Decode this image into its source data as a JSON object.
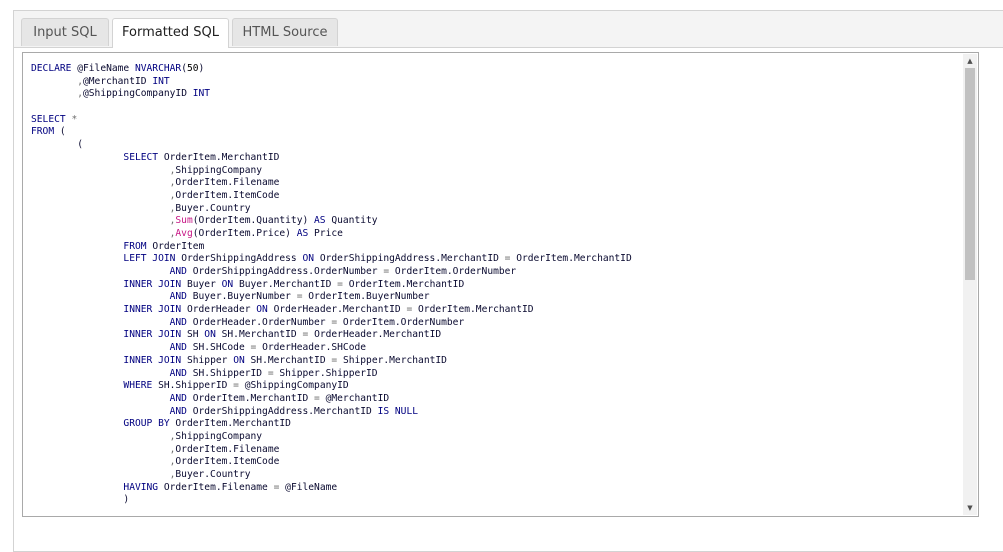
{
  "tabs": [
    {
      "label": "Input SQL"
    },
    {
      "label": "Formatted SQL"
    },
    {
      "label": "HTML Source"
    }
  ],
  "active_tab": "Formatted SQL",
  "scrollbar": {
    "up_icon": "▲",
    "down_icon": "▼"
  },
  "code_lines": [
    [
      [
        "kw",
        "DECLARE "
      ],
      [
        "id",
        "@FileName "
      ],
      [
        "kw",
        "NVARCHAR"
      ],
      [
        "id",
        "("
      ],
      [
        "num",
        "50"
      ],
      [
        "id",
        ")"
      ]
    ],
    [
      [
        "id",
        "        "
      ],
      [
        "op",
        ","
      ],
      [
        "id",
        "@MerchantID "
      ],
      [
        "kw",
        "INT"
      ]
    ],
    [
      [
        "id",
        "        "
      ],
      [
        "op",
        ","
      ],
      [
        "id",
        "@ShippingCompanyID "
      ],
      [
        "kw",
        "INT"
      ]
    ],
    [],
    [
      [
        "kw",
        "SELECT "
      ],
      [
        "op",
        "*"
      ]
    ],
    [
      [
        "kw",
        "FROM "
      ],
      [
        "id",
        "("
      ]
    ],
    [
      [
        "id",
        "        ("
      ]
    ],
    [
      [
        "id",
        "                "
      ],
      [
        "kw",
        "SELECT "
      ],
      [
        "id",
        "OrderItem.MerchantID"
      ]
    ],
    [
      [
        "id",
        "                        "
      ],
      [
        "op",
        ","
      ],
      [
        "id",
        "ShippingCompany"
      ]
    ],
    [
      [
        "id",
        "                        "
      ],
      [
        "op",
        ","
      ],
      [
        "id",
        "OrderItem.Filename"
      ]
    ],
    [
      [
        "id",
        "                        "
      ],
      [
        "op",
        ","
      ],
      [
        "id",
        "OrderItem.ItemCode"
      ]
    ],
    [
      [
        "id",
        "                        "
      ],
      [
        "op",
        ","
      ],
      [
        "id",
        "Buyer.Country"
      ]
    ],
    [
      [
        "id",
        "                        "
      ],
      [
        "op",
        ","
      ],
      [
        "fn",
        "Sum"
      ],
      [
        "id",
        "(OrderItem.Quantity) "
      ],
      [
        "kw",
        "AS "
      ],
      [
        "id",
        "Quantity"
      ]
    ],
    [
      [
        "id",
        "                        "
      ],
      [
        "op",
        ","
      ],
      [
        "fn",
        "Avg"
      ],
      [
        "id",
        "(OrderItem.Price) "
      ],
      [
        "kw",
        "AS "
      ],
      [
        "id",
        "Price"
      ]
    ],
    [
      [
        "id",
        "                "
      ],
      [
        "kw",
        "FROM "
      ],
      [
        "id",
        "OrderItem"
      ]
    ],
    [
      [
        "id",
        "                "
      ],
      [
        "kw",
        "LEFT JOIN "
      ],
      [
        "id",
        "OrderShippingAddress "
      ],
      [
        "kw",
        "ON "
      ],
      [
        "id",
        "OrderShippingAddress.MerchantID "
      ],
      [
        "op",
        "= "
      ],
      [
        "id",
        "OrderItem.MerchantID"
      ]
    ],
    [
      [
        "id",
        "                        "
      ],
      [
        "kw",
        "AND "
      ],
      [
        "id",
        "OrderShippingAddress.OrderNumber "
      ],
      [
        "op",
        "= "
      ],
      [
        "id",
        "OrderItem.OrderNumber"
      ]
    ],
    [
      [
        "id",
        "                "
      ],
      [
        "kw",
        "INNER JOIN "
      ],
      [
        "id",
        "Buyer "
      ],
      [
        "kw",
        "ON "
      ],
      [
        "id",
        "Buyer.MerchantID "
      ],
      [
        "op",
        "= "
      ],
      [
        "id",
        "OrderItem.MerchantID"
      ]
    ],
    [
      [
        "id",
        "                        "
      ],
      [
        "kw",
        "AND "
      ],
      [
        "id",
        "Buyer.BuyerNumber "
      ],
      [
        "op",
        "= "
      ],
      [
        "id",
        "OrderItem.BuyerNumber"
      ]
    ],
    [
      [
        "id",
        "                "
      ],
      [
        "kw",
        "INNER JOIN "
      ],
      [
        "id",
        "OrderHeader "
      ],
      [
        "kw",
        "ON "
      ],
      [
        "id",
        "OrderHeader.MerchantID "
      ],
      [
        "op",
        "= "
      ],
      [
        "id",
        "OrderItem.MerchantID"
      ]
    ],
    [
      [
        "id",
        "                        "
      ],
      [
        "kw",
        "AND "
      ],
      [
        "id",
        "OrderHeader.OrderNumber "
      ],
      [
        "op",
        "= "
      ],
      [
        "id",
        "OrderItem.OrderNumber"
      ]
    ],
    [
      [
        "id",
        "                "
      ],
      [
        "kw",
        "INNER JOIN "
      ],
      [
        "id",
        "SH "
      ],
      [
        "kw",
        "ON "
      ],
      [
        "id",
        "SH.MerchantID "
      ],
      [
        "op",
        "= "
      ],
      [
        "id",
        "OrderHeader.MerchantID"
      ]
    ],
    [
      [
        "id",
        "                        "
      ],
      [
        "kw",
        "AND "
      ],
      [
        "id",
        "SH.SHCode "
      ],
      [
        "op",
        "= "
      ],
      [
        "id",
        "OrderHeader.SHCode"
      ]
    ],
    [
      [
        "id",
        "                "
      ],
      [
        "kw",
        "INNER JOIN "
      ],
      [
        "id",
        "Shipper "
      ],
      [
        "kw",
        "ON "
      ],
      [
        "id",
        "SH.MerchantID "
      ],
      [
        "op",
        "= "
      ],
      [
        "id",
        "Shipper.MerchantID"
      ]
    ],
    [
      [
        "id",
        "                        "
      ],
      [
        "kw",
        "AND "
      ],
      [
        "id",
        "SH.ShipperID "
      ],
      [
        "op",
        "= "
      ],
      [
        "id",
        "Shipper.ShipperID"
      ]
    ],
    [
      [
        "id",
        "                "
      ],
      [
        "kw",
        "WHERE "
      ],
      [
        "id",
        "SH.ShipperID "
      ],
      [
        "op",
        "= "
      ],
      [
        "id",
        "@ShippingCompanyID"
      ]
    ],
    [
      [
        "id",
        "                        "
      ],
      [
        "kw",
        "AND "
      ],
      [
        "id",
        "OrderItem.MerchantID "
      ],
      [
        "op",
        "= "
      ],
      [
        "id",
        "@MerchantID"
      ]
    ],
    [
      [
        "id",
        "                        "
      ],
      [
        "kw",
        "AND "
      ],
      [
        "id",
        "OrderShippingAddress.MerchantID "
      ],
      [
        "kw",
        "IS NULL"
      ]
    ],
    [
      [
        "id",
        "                "
      ],
      [
        "kw",
        "GROUP BY "
      ],
      [
        "id",
        "OrderItem.MerchantID"
      ]
    ],
    [
      [
        "id",
        "                        "
      ],
      [
        "op",
        ","
      ],
      [
        "id",
        "ShippingCompany"
      ]
    ],
    [
      [
        "id",
        "                        "
      ],
      [
        "op",
        ","
      ],
      [
        "id",
        "OrderItem.Filename"
      ]
    ],
    [
      [
        "id",
        "                        "
      ],
      [
        "op",
        ","
      ],
      [
        "id",
        "OrderItem.ItemCode"
      ]
    ],
    [
      [
        "id",
        "                        "
      ],
      [
        "op",
        ","
      ],
      [
        "id",
        "Buyer.Country"
      ]
    ],
    [
      [
        "id",
        "                "
      ],
      [
        "kw",
        "HAVING "
      ],
      [
        "id",
        "OrderItem.Filename "
      ],
      [
        "op",
        "= "
      ],
      [
        "id",
        "@FileName"
      ]
    ],
    [
      [
        "id",
        "                )"
      ]
    ]
  ]
}
